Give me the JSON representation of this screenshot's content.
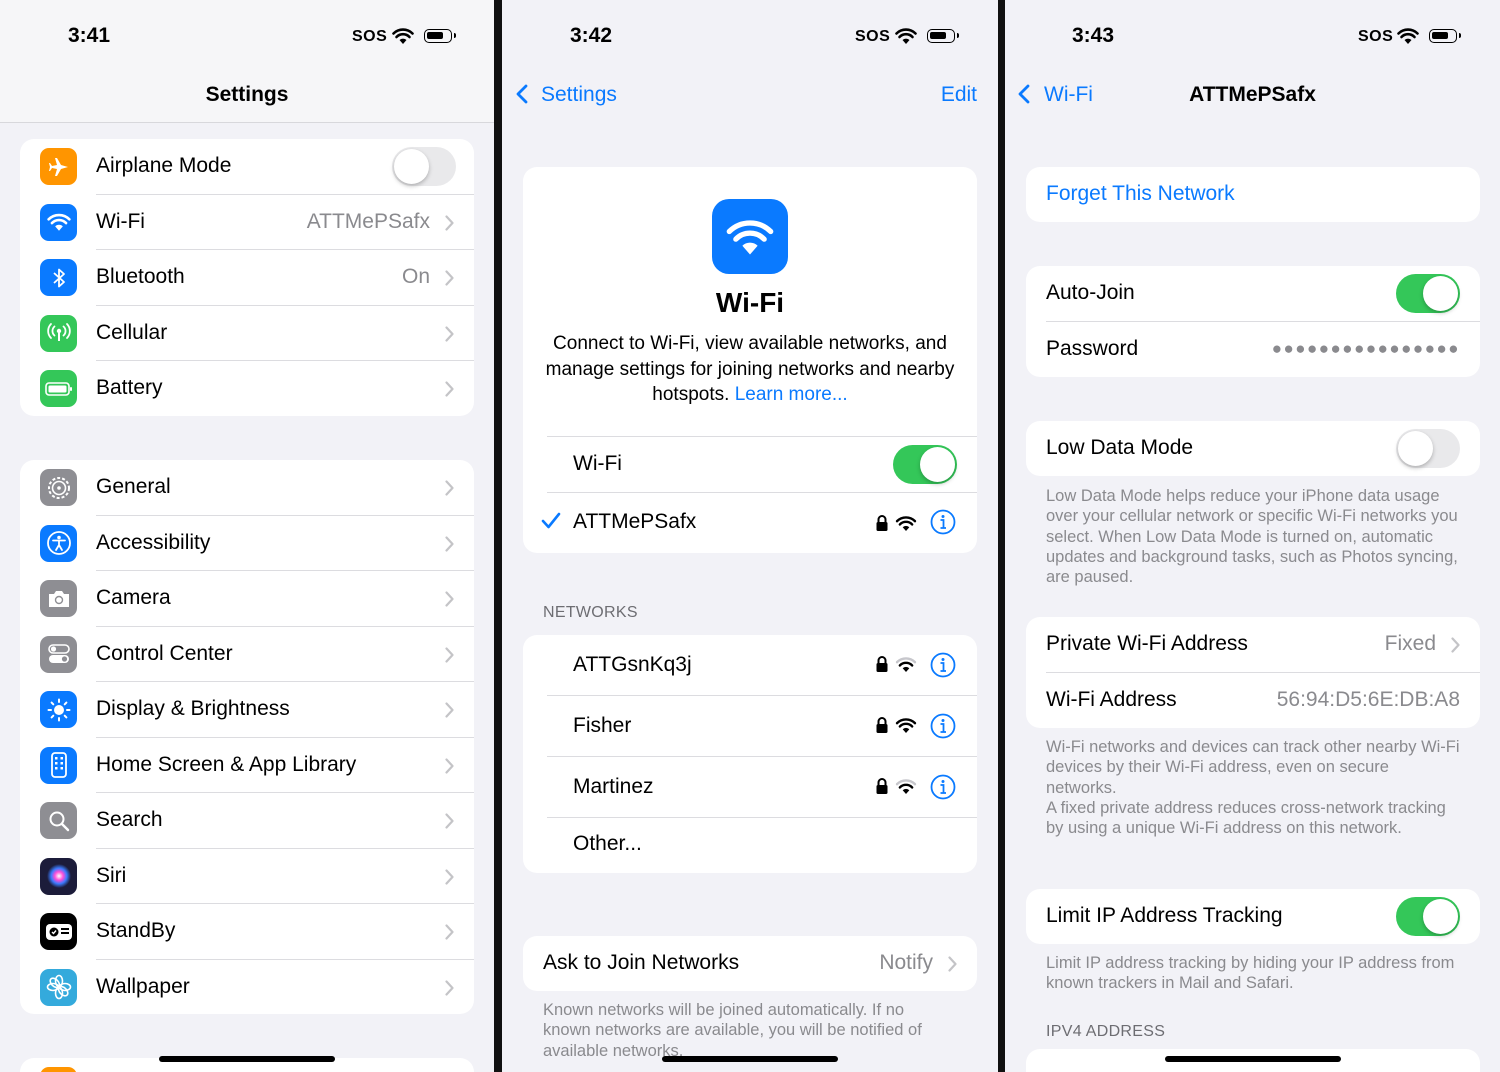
{
  "screen1": {
    "time": "3:41",
    "sos": "SOS",
    "title": "Settings",
    "group1": [
      {
        "label": "Airplane Mode",
        "icon": "airplane-icon",
        "color": "#ff9500"
      },
      {
        "label": "Wi-Fi",
        "value": "ATTMePSafx",
        "icon": "wifi-icon",
        "color": "#0a7aff"
      },
      {
        "label": "Bluetooth",
        "value": "On",
        "icon": "bluetooth-icon",
        "color": "#0a7aff"
      },
      {
        "label": "Cellular",
        "icon": "cellular-icon",
        "color": "#34c759"
      },
      {
        "label": "Battery",
        "icon": "battery-icon",
        "color": "#34c759"
      }
    ],
    "airplane_on": false,
    "group2": [
      {
        "label": "General",
        "icon": "gear-icon",
        "color": "#8e8e93"
      },
      {
        "label": "Accessibility",
        "icon": "accessibility-icon",
        "color": "#0a7aff"
      },
      {
        "label": "Camera",
        "icon": "camera-icon",
        "color": "#8e8e93"
      },
      {
        "label": "Control Center",
        "icon": "control-center-icon",
        "color": "#8e8e93"
      },
      {
        "label": "Display & Brightness",
        "icon": "brightness-icon",
        "color": "#0a7aff"
      },
      {
        "label": "Home Screen & App Library",
        "icon": "home-screen-icon",
        "color": "#0a7aff"
      },
      {
        "label": "Search",
        "icon": "search-icon",
        "color": "#8e8e93"
      },
      {
        "label": "Siri",
        "icon": "siri-icon",
        "color": "#1c1c3a"
      },
      {
        "label": "StandBy",
        "icon": "standby-icon",
        "color": "#000000"
      },
      {
        "label": "Wallpaper",
        "icon": "wallpaper-icon",
        "color": "#34aadc"
      }
    ]
  },
  "screen2": {
    "time": "3:42",
    "sos": "SOS",
    "back": "Settings",
    "edit": "Edit",
    "header_title": "Wi-Fi",
    "header_desc": "Connect to Wi-Fi, view available networks, and manage settings for joining networks and nearby hotspots.",
    "learn_more": "Learn more...",
    "wifi_label": "Wi-Fi",
    "wifi_on": true,
    "connected": "ATTMePSafx",
    "networks_header": "NETWORKS",
    "networks": [
      {
        "name": "ATTGsnKq3j",
        "signal": "medium"
      },
      {
        "name": "Fisher",
        "signal": "full"
      },
      {
        "name": "Martinez",
        "signal": "medium"
      }
    ],
    "other": "Other...",
    "ask_label": "Ask to Join Networks",
    "ask_value": "Notify",
    "ask_caption": "Known networks will be joined automatically. If no known networks are available, you will be notified of available networks."
  },
  "screen3": {
    "time": "3:43",
    "sos": "SOS",
    "back": "Wi-Fi",
    "title": "ATTMePSafx",
    "forget": "Forget This Network",
    "auto_join": "Auto-Join",
    "auto_join_on": true,
    "password": "Password",
    "password_dots": "●●●●●●●●●●●●●●●●",
    "low_data": "Low Data Mode",
    "low_data_on": false,
    "low_data_caption": "Low Data Mode helps reduce your iPhone data usage over your cellular network or specific Wi-Fi networks you select. When Low Data Mode is turned on, automatic updates and background tasks, such as Photos syncing, are paused.",
    "private_addr": "Private Wi-Fi Address",
    "private_addr_value": "Fixed",
    "wifi_addr": "Wi-Fi Address",
    "wifi_addr_value": "56:94:D5:6E:DB:A8",
    "addr_caption1": "Wi-Fi networks and devices can track other nearby Wi-Fi devices by their Wi-Fi address, even on secure networks.",
    "addr_caption2": "A fixed private address reduces cross-network tracking by using a unique Wi-Fi address on this network.",
    "limit_ip": "Limit IP Address Tracking",
    "limit_ip_on": true,
    "limit_caption": "Limit IP address tracking by hiding your IP address from known trackers in Mail and Safari.",
    "ipv4_header": "IPV4 ADDRESS"
  }
}
